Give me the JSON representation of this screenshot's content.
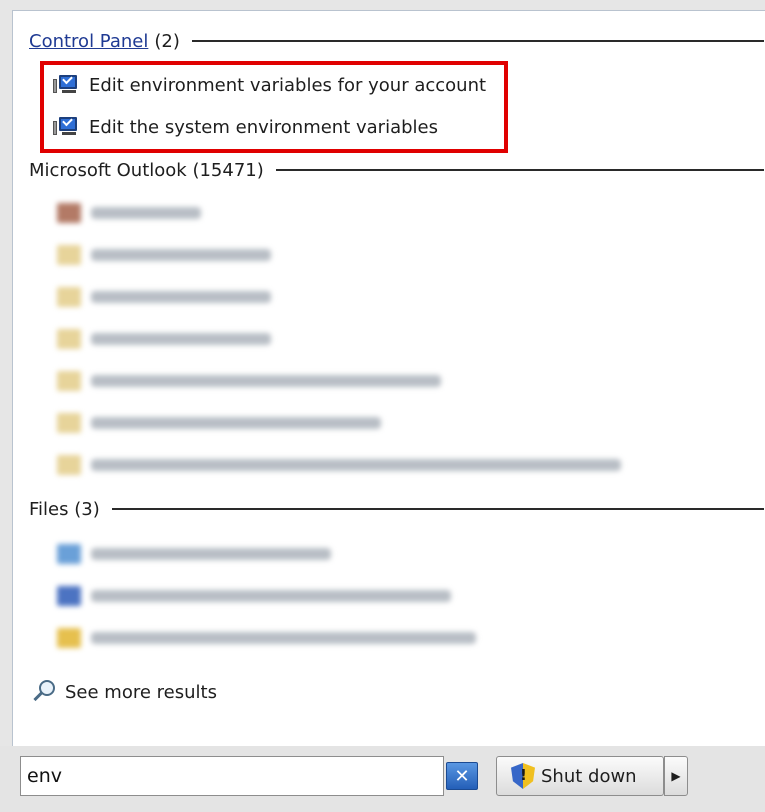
{
  "control_panel": {
    "header_label": "Control Panel",
    "header_count": "(2)",
    "items": [
      {
        "label": "Edit environment variables for your account",
        "icon": "control-panel-icon"
      },
      {
        "label": "Edit the system environment variables",
        "icon": "control-panel-icon"
      }
    ]
  },
  "outlook": {
    "header_label": "Microsoft Outlook (15471)",
    "item_count_visible": 7
  },
  "files": {
    "header_label": "Files (3)",
    "item_count_visible": 3
  },
  "see_more": {
    "label": "See more results",
    "icon": "magnifier-icon"
  },
  "search": {
    "value": "env"
  },
  "shutdown": {
    "label": "Shut down",
    "icon": "uac-shield-icon"
  },
  "colors": {
    "highlight": "#e00000",
    "link": "#1f3a93"
  }
}
